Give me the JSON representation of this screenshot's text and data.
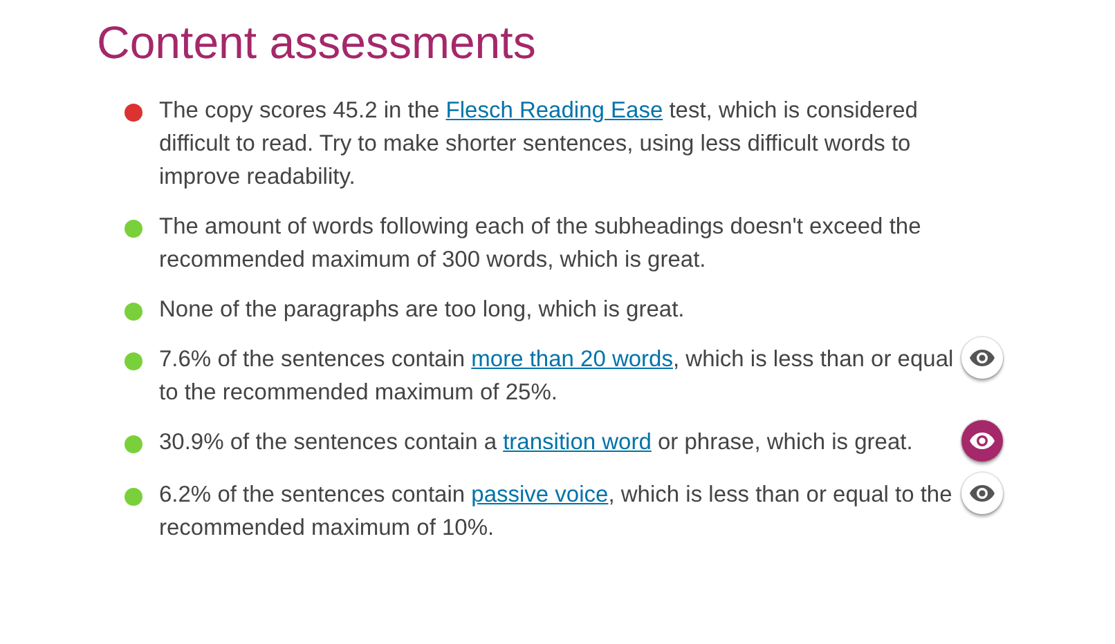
{
  "title": "Content assessments",
  "assessments": [
    {
      "color": "#dc3232",
      "before": "The copy scores 45.2 in the ",
      "link": "Flesch Reading Ease",
      "after": " test, which is considered difficult to read. Try to make shorter sentences, using less difficult words to improve readability."
    },
    {
      "color": "#7ad03a",
      "before": "The amount of words following each of the subheadings doesn't exceed the recommended maximum of 300 words, which is great."
    },
    {
      "color": "#7ad03a",
      "before": "None of the paragraphs are too long, which is great."
    },
    {
      "color": "#7ad03a",
      "before": "7.6% of the sentences contain ",
      "link": "more than 20 words",
      "after": ", which is less than or equal to the recommended maximum of 25%.",
      "eye": {
        "selected": false
      }
    },
    {
      "color": "#7ad03a",
      "before": "30.9% of the sentences contain a ",
      "link": "transition word",
      "after": " or phrase, which is great.",
      "eye": {
        "selected": true
      }
    },
    {
      "color": "#7ad03a",
      "before": "6.2% of the sentences contain ",
      "link": "passive voice",
      "after": ", which is less than or equal to the recommended maximum of 10%.",
      "eye": {
        "selected": false
      }
    }
  ]
}
